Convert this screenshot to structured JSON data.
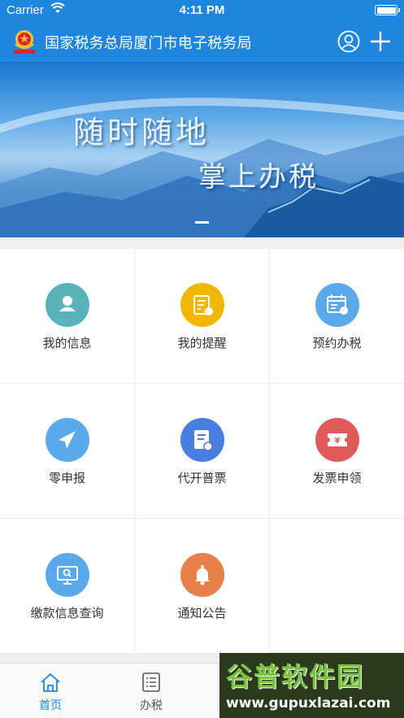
{
  "status_bar": {
    "carrier": "Carrier",
    "time": "4:11 PM"
  },
  "nav": {
    "title": "国家税务总局厦门市电子税务局"
  },
  "banner": {
    "slogan_line1": "随时随地",
    "slogan_line2": "掌上办税"
  },
  "services": [
    {
      "label": "我的信息",
      "icon": "user-icon",
      "color": "#5ab3b8"
    },
    {
      "label": "我的提醒",
      "icon": "note-clock-icon",
      "color": "#f2b705"
    },
    {
      "label": "预约办税",
      "icon": "calendar-clock-icon",
      "color": "#5aa9ea"
    },
    {
      "label": "零申报",
      "icon": "paper-plane-icon",
      "color": "#5aa9ea"
    },
    {
      "label": "代开普票",
      "icon": "document-edit-icon",
      "color": "#4a7de0"
    },
    {
      "label": "发票申领",
      "icon": "yuan-ticket-icon",
      "color": "#e05a5a"
    },
    {
      "label": "缴款信息查询",
      "icon": "monitor-search-icon",
      "color": "#5aa9ea"
    },
    {
      "label": "通知公告",
      "icon": "bell-icon",
      "color": "#e8804a"
    }
  ],
  "tabs": [
    {
      "label": "首页",
      "active": true
    },
    {
      "label": "办税",
      "active": false
    }
  ],
  "colors": {
    "primary": "#1f86de",
    "tab_active": "#1f86de",
    "tab_inactive": "#555555"
  },
  "watermark": {
    "name": "谷普软件园",
    "url": "www.gupuxlazai.com"
  }
}
